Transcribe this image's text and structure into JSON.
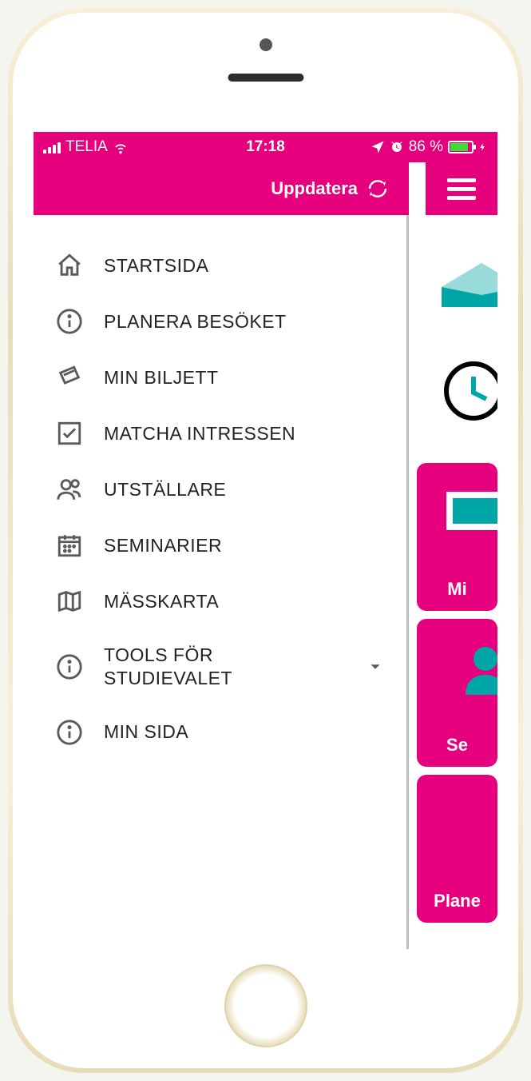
{
  "statusbar": {
    "carrier": "TELIA",
    "time": "17:18",
    "battery_pct": "86 %"
  },
  "drawer": {
    "update_label": "Uppdatera",
    "items": [
      {
        "icon": "home",
        "label": "STARTSIDA"
      },
      {
        "icon": "info",
        "label": "PLANERA BESÖKET"
      },
      {
        "icon": "ticket",
        "label": "MIN BILJETT"
      },
      {
        "icon": "check",
        "label": "MATCHA INTRESSEN"
      },
      {
        "icon": "people",
        "label": "UTSTÄLLARE"
      },
      {
        "icon": "calendar",
        "label": "SEMINARIER"
      },
      {
        "icon": "map",
        "label": "MÄSSKARTA"
      },
      {
        "icon": "info",
        "label": "TOOLS FÖR STUDIEVALET",
        "expandable": true
      },
      {
        "icon": "info",
        "label": "MIN SIDA"
      }
    ]
  },
  "peek_cards": [
    {
      "label": "Mi"
    },
    {
      "label": "Se"
    },
    {
      "label": "Plane"
    }
  ],
  "colors": {
    "brand": "#e6007e",
    "teal": "#00a6a6"
  }
}
